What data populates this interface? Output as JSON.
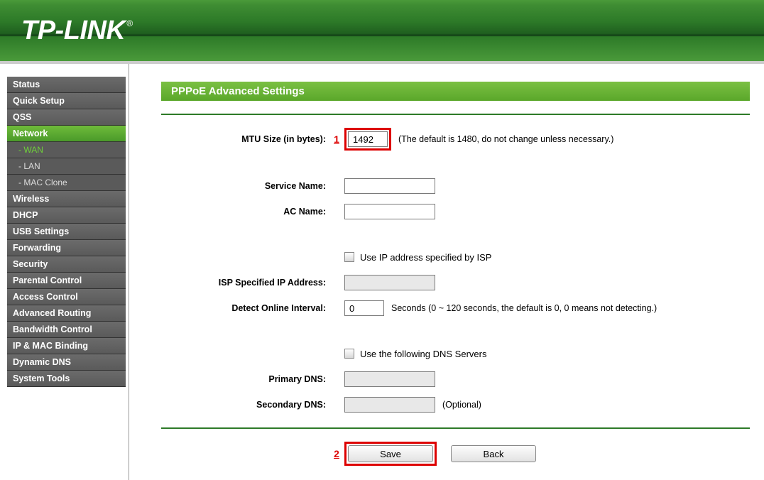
{
  "brand": "TP-LINK",
  "sidebar": {
    "items": [
      {
        "label": "Status"
      },
      {
        "label": "Quick Setup"
      },
      {
        "label": "QSS"
      },
      {
        "label": "Network",
        "active": true
      },
      {
        "label": "Wireless"
      },
      {
        "label": "DHCP"
      },
      {
        "label": "USB Settings"
      },
      {
        "label": "Forwarding"
      },
      {
        "label": "Security"
      },
      {
        "label": "Parental Control"
      },
      {
        "label": "Access Control"
      },
      {
        "label": "Advanced Routing"
      },
      {
        "label": "Bandwidth Control"
      },
      {
        "label": "IP & MAC Binding"
      },
      {
        "label": "Dynamic DNS"
      },
      {
        "label": "System Tools"
      }
    ],
    "subitems": [
      {
        "label": "- WAN",
        "active": true
      },
      {
        "label": "- LAN"
      },
      {
        "label": "- MAC Clone"
      }
    ]
  },
  "page": {
    "title": "PPPoE Advanced Settings"
  },
  "form": {
    "mtu_label": "MTU Size (in bytes):",
    "mtu_value": "1492",
    "mtu_hint": "(The default is 1480, do not change unless necessary.)",
    "service_name_label": "Service Name:",
    "service_name_value": "",
    "ac_name_label": "AC Name:",
    "ac_name_value": "",
    "use_isp_ip_label": "Use IP address specified by ISP",
    "isp_ip_label": "ISP Specified IP Address:",
    "isp_ip_value": "",
    "detect_interval_label": "Detect Online Interval:",
    "detect_interval_value": "0",
    "detect_interval_hint": "Seconds (0 ~ 120 seconds, the default is 0, 0 means not detecting.)",
    "use_dns_label": "Use the following DNS Servers",
    "primary_dns_label": "Primary DNS:",
    "primary_dns_value": "",
    "secondary_dns_label": "Secondary DNS:",
    "secondary_dns_value": "",
    "secondary_dns_hint": "(Optional)"
  },
  "buttons": {
    "save": "Save",
    "back": "Back"
  },
  "annotations": {
    "a1": "1",
    "a2": "2"
  }
}
